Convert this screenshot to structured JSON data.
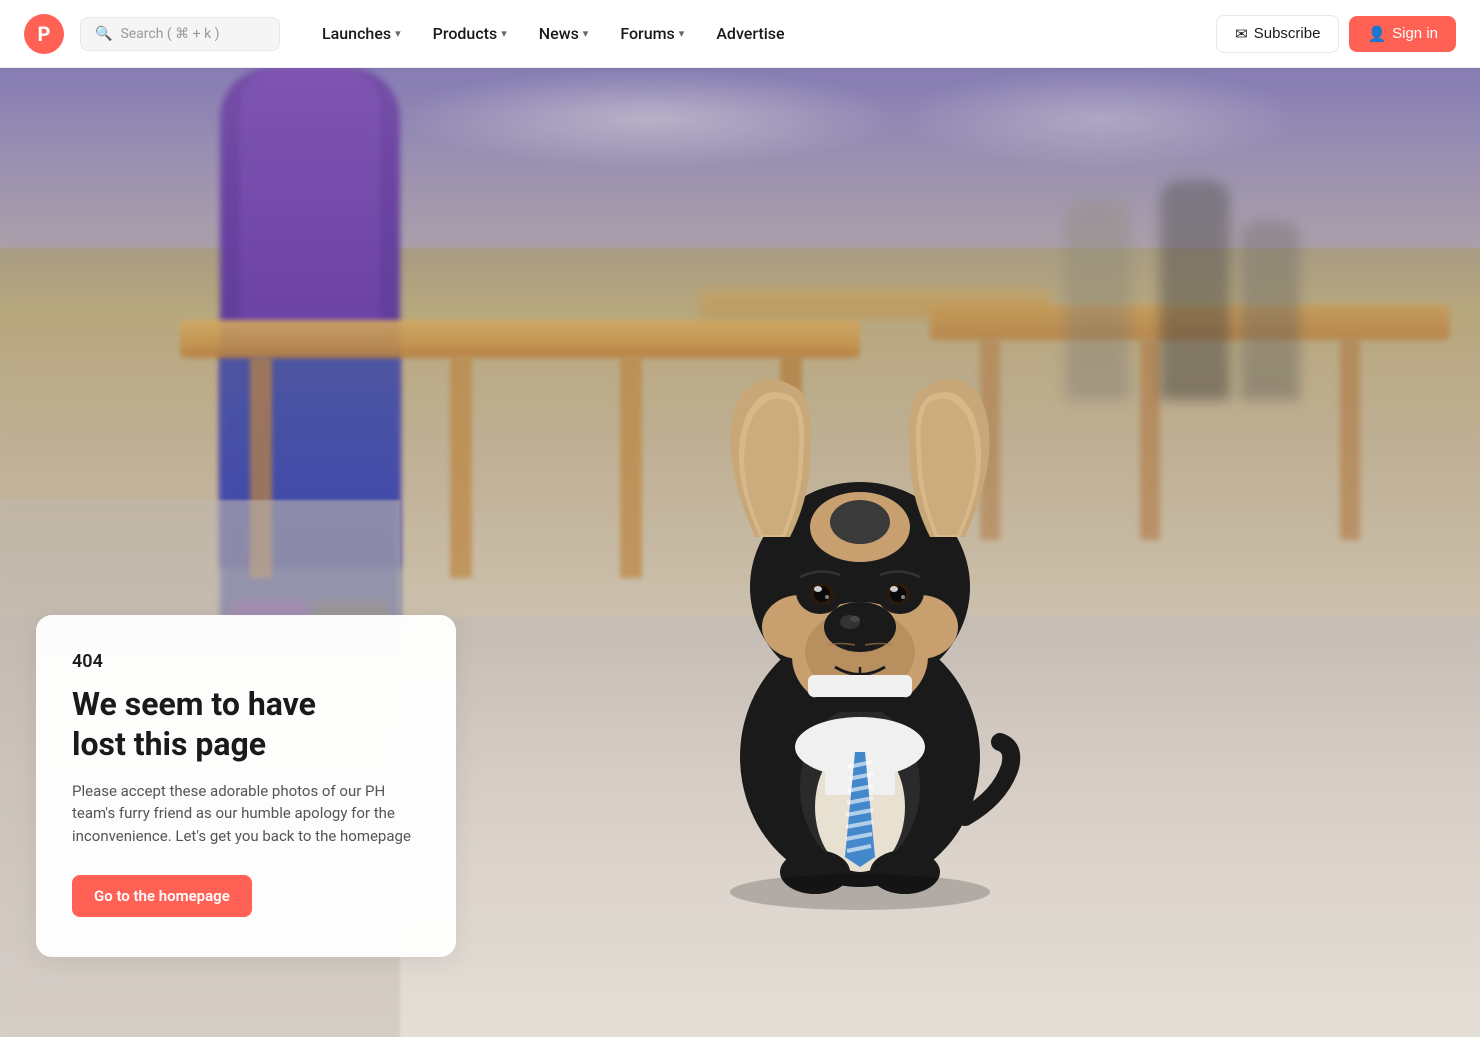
{
  "nav": {
    "logo_letter": "P",
    "search_placeholder": "Search ( ⌘ + k )",
    "links": [
      {
        "label": "Launches",
        "has_dropdown": true
      },
      {
        "label": "Products",
        "has_dropdown": true
      },
      {
        "label": "News",
        "has_dropdown": true
      },
      {
        "label": "Forums",
        "has_dropdown": true
      },
      {
        "label": "Advertise",
        "has_dropdown": false
      }
    ],
    "subscribe_label": "Subscribe",
    "signin_label": "Sign in"
  },
  "error": {
    "code": "404",
    "title_line1": "We seem to have",
    "title_line2": "lost this page",
    "description": "Please accept these adorable photos of our PH team's furry friend as our humble apology for the inconvenience. Let's get you back to the homepage",
    "cta_label": "Go to the homepage"
  },
  "colors": {
    "brand": "#ff6154",
    "text_primary": "#1a1a1a",
    "text_secondary": "#555555"
  }
}
